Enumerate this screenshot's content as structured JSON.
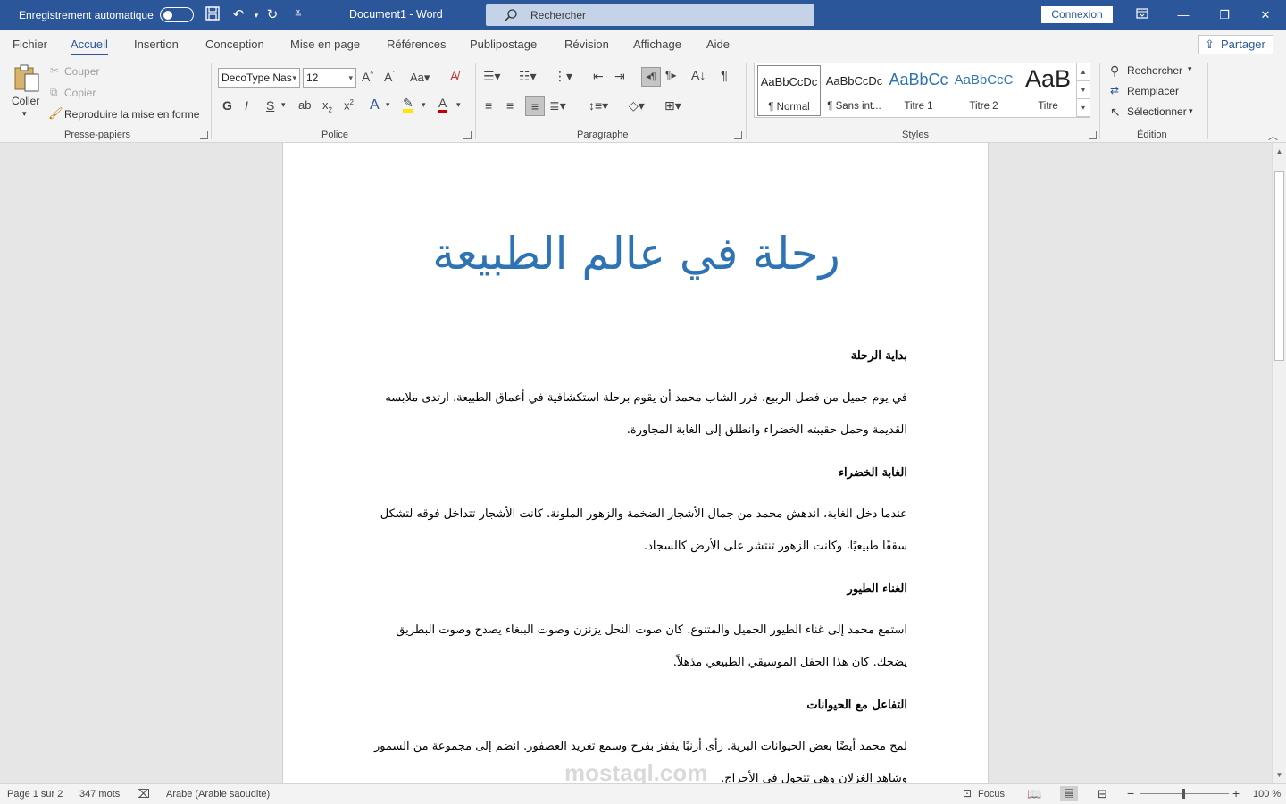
{
  "titlebar": {
    "autosave_label": "Enregistrement automatique",
    "doc_title": "Document1  -  Word",
    "search_placeholder": "Rechercher",
    "connexion_label": "Connexion"
  },
  "menu": {
    "tabs": [
      "Fichier",
      "Accueil",
      "Insertion",
      "Conception",
      "Mise en page",
      "Références",
      "Publipostage",
      "Révision",
      "Affichage",
      "Aide"
    ],
    "active_tab": "Accueil",
    "share_label": "Partager"
  },
  "ribbon": {
    "clipboard": {
      "paste_label": "Coller",
      "cut_label": "Couper",
      "copy_label": "Copier",
      "format_painter_label": "Reproduire la mise en forme",
      "group_label": "Presse-papiers"
    },
    "font": {
      "font_name": "DecoType Nas",
      "font_size": "12",
      "group_label": "Police"
    },
    "paragraph": {
      "group_label": "Paragraphe"
    },
    "styles": {
      "items": [
        {
          "preview": "AaBbCcDc",
          "name": "¶ Normal"
        },
        {
          "preview": "AaBbCcDc",
          "name": "¶ Sans int..."
        },
        {
          "preview": "AaBbCc",
          "name": "Titre 1"
        },
        {
          "preview": "AaBbCcC",
          "name": "Titre 2"
        },
        {
          "preview": "AaB",
          "name": "Titre"
        }
      ],
      "group_label": "Styles"
    },
    "editing": {
      "find_label": "Rechercher",
      "replace_label": "Remplacer",
      "select_label": "Sélectionner",
      "group_label": "Édition"
    }
  },
  "document": {
    "title": "رحلة في عالم الطبيعة",
    "sections": [
      {
        "heading": "بداية الرحلة",
        "body": "في يوم جميل من فصل الربيع، قرر الشاب محمد أن يقوم برحلة استكشافية في أعماق الطبيعة. ارتدى ملابسه القديمة وحمل حقيبته الخضراء وانطلق إلى الغابة المجاورة."
      },
      {
        "heading": "الغابة الخضراء",
        "body": "عندما دخل الغابة، اندهش محمد من جمال الأشجار الضخمة والزهور الملونة. كانت الأشجار تتداخل فوقه لتشكل سقفًا طبيعيًا، وكانت الزهور تنتشر على الأرض كالسجاد."
      },
      {
        "heading": "الغناء الطيور",
        "body": "استمع محمد إلى غناء الطيور الجميل والمتنوع. كان صوت النحل يزنزن وصوت الببغاء يصدح وصوت البطريق يضحك. كان هذا الحفل الموسيقي الطبيعي مذهلاً."
      },
      {
        "heading": "التفاعل مع الحيوانات",
        "body": "لمح محمد أيضًا بعض الحيوانات البرية. رأى أرنبًا يقفز بفرح وسمع تغريد العصفور. انضم إلى مجموعة من السمور وشاهد الغزلان وهي تتجول في الأحراج."
      }
    ]
  },
  "watermark": "mostaql.com",
  "statusbar": {
    "page": "Page 1 sur 2",
    "words": "347 mots",
    "language": "Arabe (Arabie saoudite)",
    "focus": "Focus",
    "zoom": "100 %"
  },
  "colors": {
    "brand": "#2b579a",
    "heading": "#2e74b5"
  }
}
